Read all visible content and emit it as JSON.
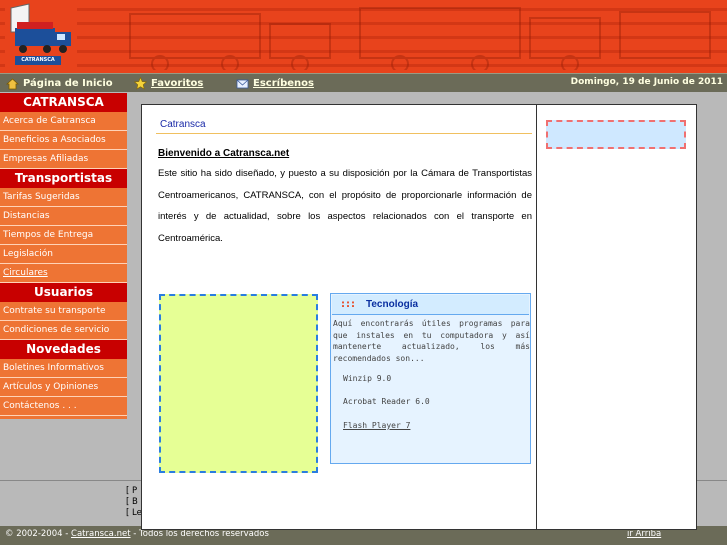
{
  "colors": {
    "header": "#e8431c",
    "nav_bar": "#6b6b58",
    "section_head": "#c80000",
    "sidebar_item": "#ee7434",
    "link_blue": "#1a2aa8"
  },
  "logo": {
    "icon": "truck-logo-icon",
    "text": "CATRANSCA"
  },
  "topnav": {
    "home": {
      "icon": "home-icon",
      "label": "Página de Inicio"
    },
    "favorites": {
      "icon": "star-icon",
      "label": "Favoritos"
    },
    "write": {
      "icon": "envelope-icon",
      "label": "Escríbenos"
    },
    "date": "Domingo, 19 de Junio de 2011"
  },
  "sidebar": {
    "sections": [
      {
        "title": "CATRANSCA",
        "items": [
          "Acerca de Catransca",
          "Beneficios a Asociados",
          "Empresas Afiliadas"
        ]
      },
      {
        "title": "Transportistas",
        "items": [
          "Tarifas Sugeridas",
          "Distancias",
          "Tiempos de Entrega",
          "Legislación",
          "Circulares"
        ]
      },
      {
        "title": "Usuarios",
        "items": [
          "Contrate su transporte",
          "Condiciones de servicio"
        ]
      },
      {
        "title": "Novedades",
        "items": [
          "Boletines Informativos",
          "Artículos y Opiniones",
          "Contáctenos . . ."
        ]
      }
    ]
  },
  "main": {
    "breadcrumb": "Catransca",
    "welcome_title": "Bienvenido a Catransca.net",
    "intro": "Este sitio ha sido diseñado, y puesto a su disposición por la Cámara de Transportistas Centroamericanos, CATRANSCA, con el propósito de proporcionarle información de interés y de actualidad, sobre los aspectos relacionados con el transporte en Centroamérica."
  },
  "tech_box": {
    "icon": ":::",
    "title": "Tecnología",
    "text": "Aquí encontrarás útiles programas para que instales en tu computadora y así mantenerte actualizado, los más recomendados son...",
    "links": [
      "Winzip 9.0",
      "Acrobat Reader 6.0",
      "Flash Player 7"
    ]
  },
  "footer": {
    "links": [
      "[ P",
      "[ B",
      "[ Le"
    ],
    "copyright_prefix": "© 2002-2004  -",
    "copyright_link": "Catransca.net",
    "copyright_suffix": " -  Todos los derechos reservados",
    "top_link": "ir Arriba"
  }
}
